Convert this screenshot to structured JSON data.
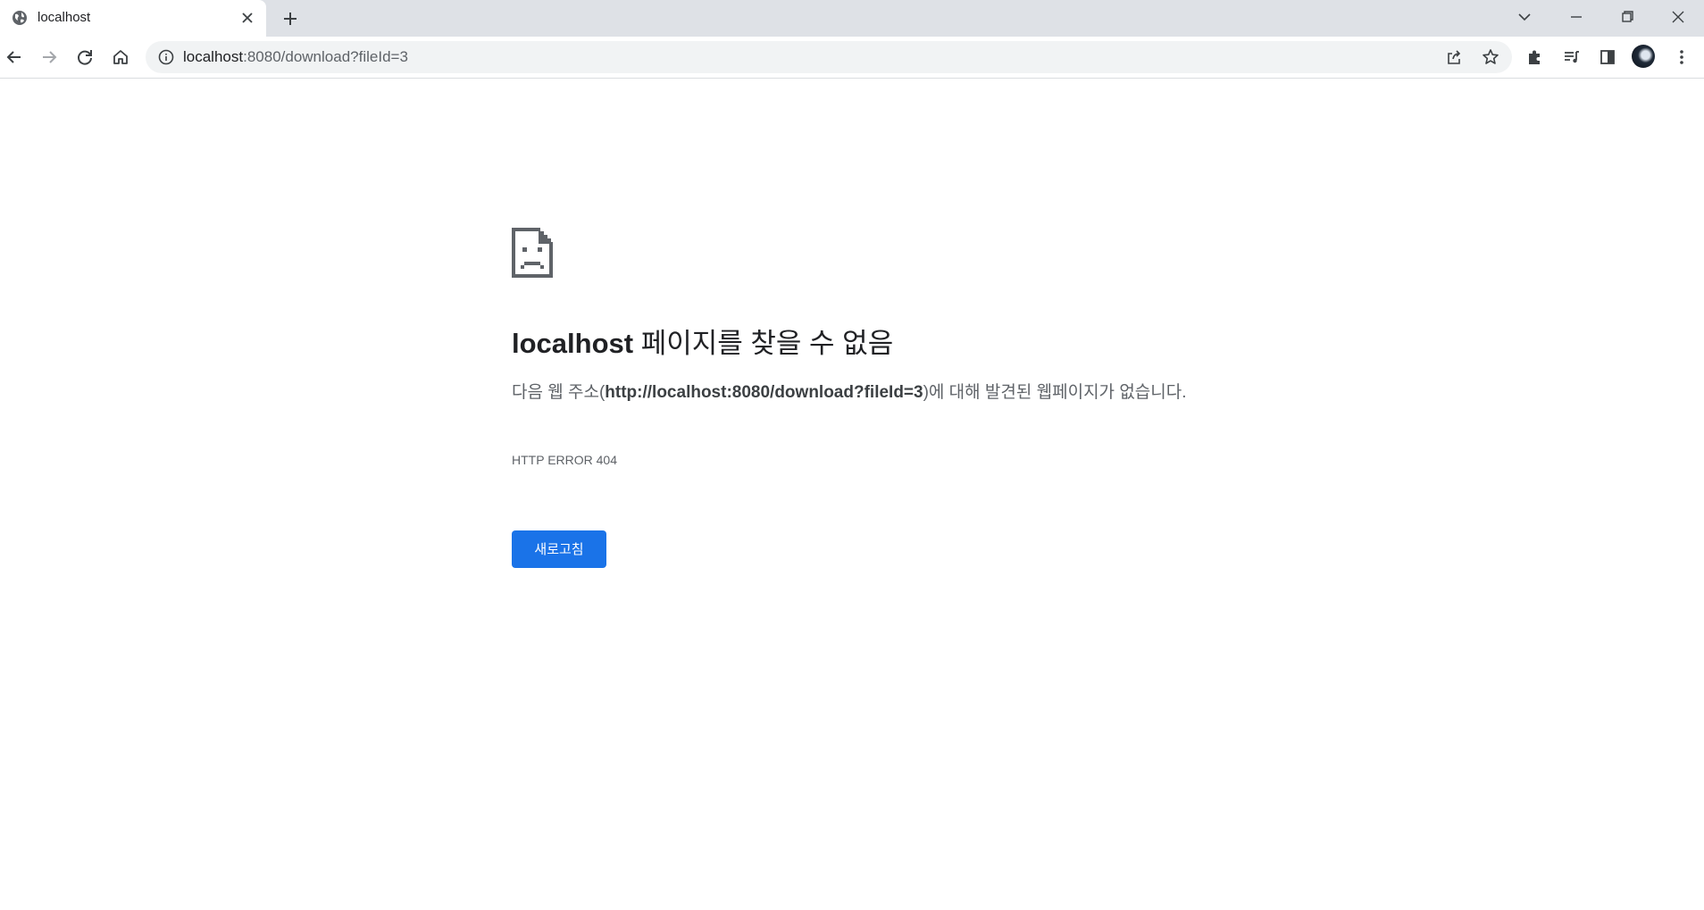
{
  "browser": {
    "tab": {
      "title": "localhost",
      "favicon": "globe-icon"
    },
    "window_controls": [
      "tab-search-icon",
      "minimize-icon",
      "restore-icon",
      "close-icon"
    ],
    "address_bar": {
      "host": "localhost",
      "rest": ":8080/download?fileId=3"
    },
    "toolbar_icons": [
      "back-icon",
      "forward-icon",
      "reload-icon",
      "home-icon",
      "share-icon",
      "star-icon",
      "extensions-icon",
      "reading-list-icon",
      "side-panel-icon",
      "profile-avatar",
      "menu-icon"
    ]
  },
  "error_page": {
    "icon": "sad-page-icon",
    "title_host": "localhost",
    "title_rest": " 페이지를 찾을 수 없음",
    "desc_before": "다음 웹 주소(",
    "desc_url": "http://localhost:8080/download?fileId=3",
    "desc_after": ")에 대해 발견된 웹페이지가 없습니다.",
    "error_code": "HTTP ERROR 404",
    "reload_label": "새로고침"
  },
  "colors": {
    "accent": "#1a73e8",
    "tabstrip_bg": "#dee1e6",
    "omnibox_bg": "#f1f3f4",
    "text": "#202124",
    "secondary_text": "#5f6368"
  }
}
